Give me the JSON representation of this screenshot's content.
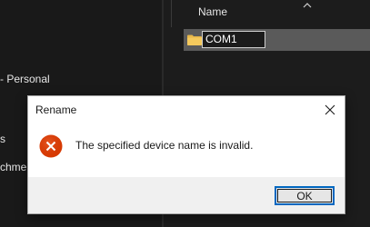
{
  "explorer": {
    "column_header": "Name",
    "nav_items": [
      {
        "label": " - Personal"
      },
      {
        "label": "s"
      },
      {
        "label": "chmer"
      }
    ],
    "file_row": {
      "rename_value": "COM1",
      "icon": "folder-icon"
    }
  },
  "dialog": {
    "title": "Rename",
    "close_icon": "close-icon",
    "message": "The specified device name is invalid.",
    "error_icon": "error-icon",
    "ok_label": "OK"
  },
  "colors": {
    "error_red": "#d83b01",
    "accent_blue": "#0067c0",
    "folder_yellow": "#e8b84a"
  }
}
